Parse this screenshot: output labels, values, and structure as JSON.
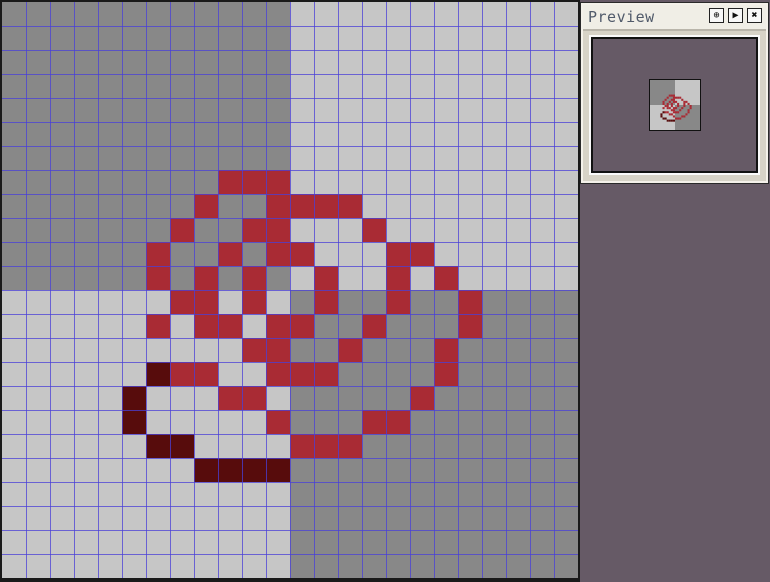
{
  "preview": {
    "title": "Preview",
    "buttons": [
      {
        "name": "fit-view-button",
        "icon": "fit-view-icon",
        "glyph": "⊕"
      },
      {
        "name": "play-animation-button",
        "icon": "play-icon",
        "glyph": "▶"
      },
      {
        "name": "close-preview-button",
        "icon": "close-icon",
        "glyph": "✖"
      }
    ]
  },
  "canvas": {
    "grid_cols": 24,
    "grid_rows": 24,
    "colors": {
      "workspace_background": "#665a66",
      "grid_line": "#4a40d8",
      "checker_dark": "#888888",
      "checker_light": "#c6c6c6",
      "red": "#a92b34",
      "dark_red": "#570c0c"
    },
    "red_pixels": [
      [
        9,
        7
      ],
      [
        10,
        7
      ],
      [
        11,
        7
      ],
      [
        8,
        8
      ],
      [
        11,
        8
      ],
      [
        12,
        8
      ],
      [
        13,
        8
      ],
      [
        14,
        8
      ],
      [
        7,
        9
      ],
      [
        10,
        9
      ],
      [
        11,
        9
      ],
      [
        15,
        9
      ],
      [
        6,
        10
      ],
      [
        9,
        10
      ],
      [
        11,
        10
      ],
      [
        12,
        10
      ],
      [
        16,
        10
      ],
      [
        17,
        10
      ],
      [
        6,
        11
      ],
      [
        8,
        11
      ],
      [
        10,
        11
      ],
      [
        13,
        11
      ],
      [
        16,
        11
      ],
      [
        18,
        11
      ],
      [
        7,
        12
      ],
      [
        8,
        12
      ],
      [
        10,
        12
      ],
      [
        13,
        12
      ],
      [
        16,
        12
      ],
      [
        19,
        12
      ],
      [
        6,
        13
      ],
      [
        8,
        13
      ],
      [
        9,
        13
      ],
      [
        11,
        13
      ],
      [
        12,
        13
      ],
      [
        15,
        13
      ],
      [
        19,
        13
      ],
      [
        10,
        14
      ],
      [
        11,
        14
      ],
      [
        14,
        14
      ],
      [
        18,
        14
      ],
      [
        7,
        15
      ],
      [
        8,
        15
      ],
      [
        11,
        15
      ],
      [
        12,
        15
      ],
      [
        13,
        15
      ],
      [
        18,
        15
      ],
      [
        9,
        16
      ],
      [
        10,
        16
      ],
      [
        17,
        16
      ],
      [
        11,
        17
      ],
      [
        15,
        17
      ],
      [
        16,
        17
      ],
      [
        12,
        18
      ],
      [
        13,
        18
      ],
      [
        14,
        18
      ]
    ],
    "dark_pixels": [
      [
        6,
        15
      ],
      [
        5,
        16
      ],
      [
        5,
        17
      ],
      [
        6,
        18
      ],
      [
        7,
        18
      ],
      [
        8,
        19
      ],
      [
        9,
        19
      ],
      [
        10,
        19
      ],
      [
        11,
        19
      ]
    ]
  }
}
